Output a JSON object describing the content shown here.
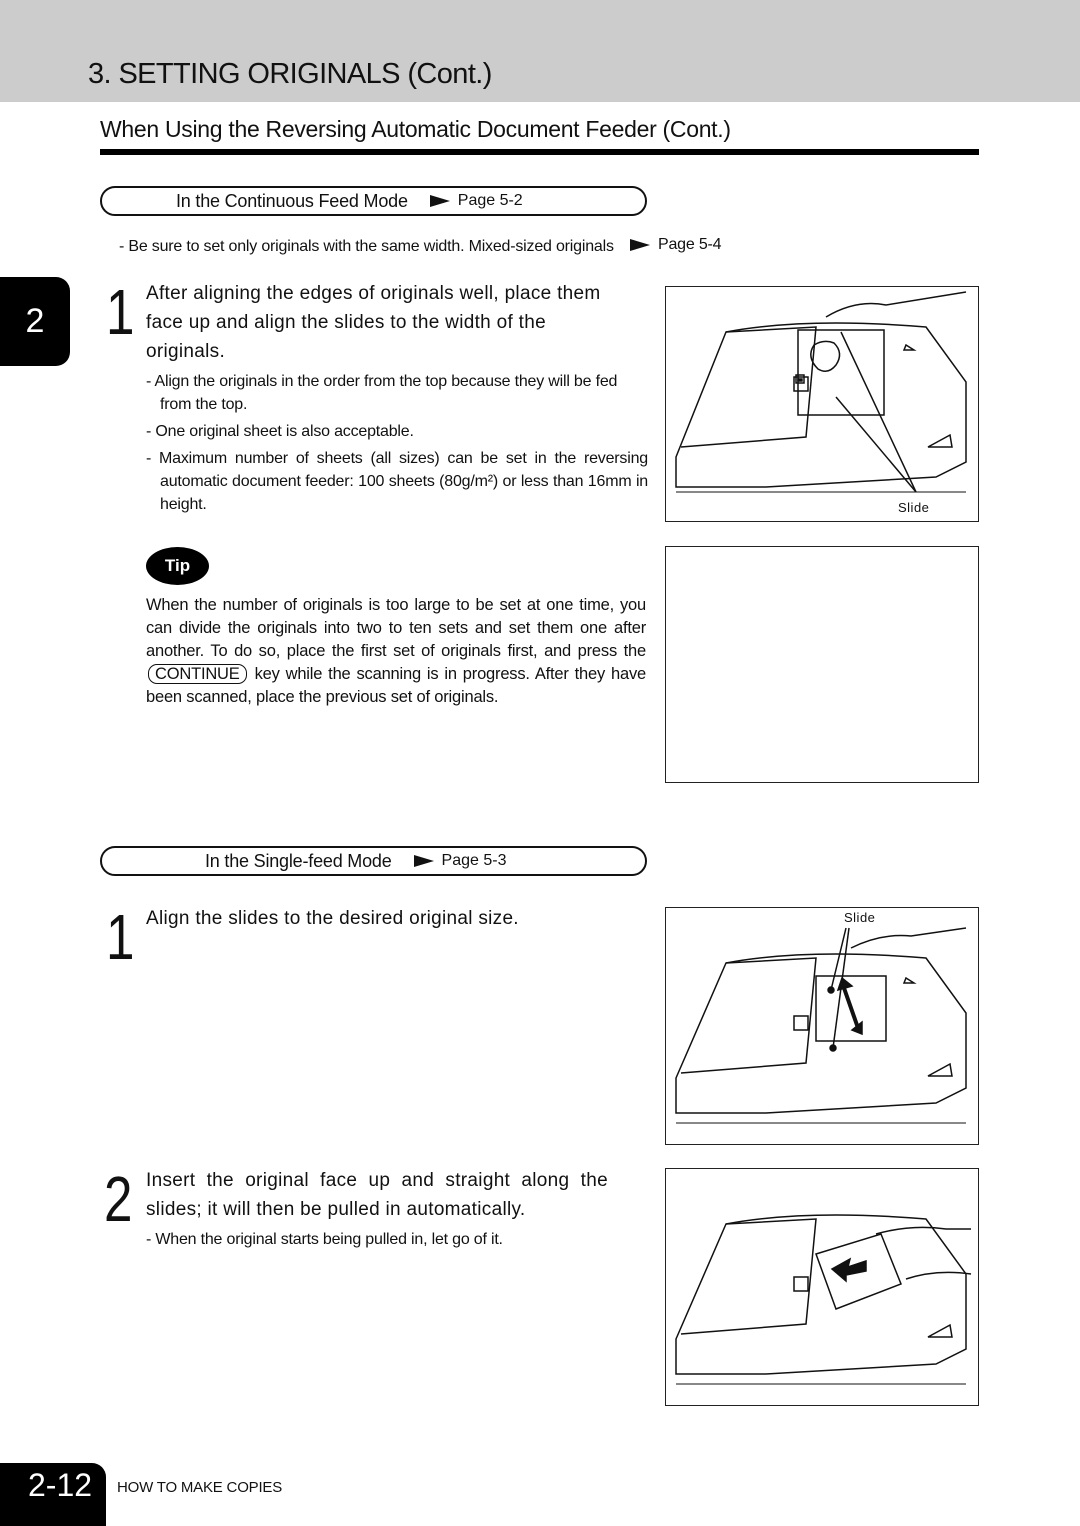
{
  "header": {
    "chapter_title": "3. SETTING ORIGINALS (Cont.)",
    "section_title": "When Using the Reversing Automatic Document Feeder (Cont.)"
  },
  "chapter_tab": {
    "number": "2"
  },
  "continuous_mode": {
    "label": "In the Continuous Feed Mode",
    "page_ref": "Page 5-2",
    "note": "- Be sure to set only originals with the same width. Mixed-sized originals",
    "note_page_ref": "Page 5-4",
    "step1": {
      "number": "1",
      "text": "After aligning the edges of originals well, place them face up and align the slides to the width of the originals.",
      "bullets": [
        "- Align the originals in the order from the top because they will be fed from the top.",
        "- One original sheet  is also acceptable.",
        "- Maximum number of sheets (all sizes) can be set in the reversing automatic document feeder: 100 sheets (80g/m²) or less than 16mm in height."
      ],
      "figure_label": "Slide"
    },
    "tip": {
      "badge": "Tip",
      "text_before": "When the number of originals is too large to be set at one time, you can divide the originals into two to ten sets and set them one after another.  To do so, place the first set of originals  first, and press the",
      "key": "CONTINUE",
      "text_after": "key while the scanning is in progress.  After they have been scanned, place the previous set of originals."
    }
  },
  "single_mode": {
    "label": "In the Single-feed Mode",
    "page_ref": "Page 5-3",
    "step1": {
      "number": "1",
      "text": "Align the slides to the desired original size.",
      "figure_label": "Slide"
    },
    "step2": {
      "number": "2",
      "text": "Insert the original face up and straight along the slides; it will then be pulled in automatically.",
      "bullets": [
        "-  When the original starts being pulled in, let go of it."
      ]
    }
  },
  "footer": {
    "page_number": "2-12",
    "section_label": "HOW TO MAKE COPIES"
  }
}
